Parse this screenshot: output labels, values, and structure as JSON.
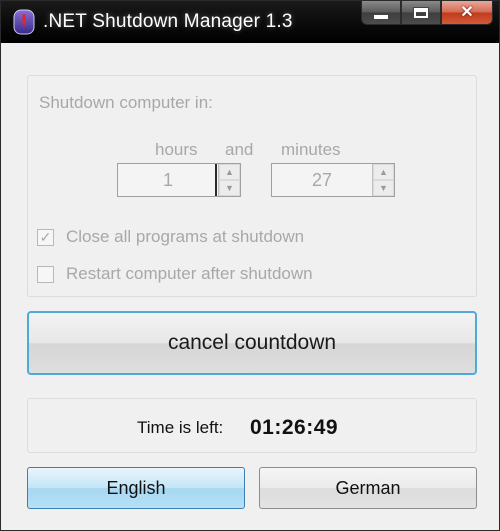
{
  "window": {
    "title": ".NET Shutdown Manager 1.3",
    "icon": "power-app-icon",
    "caption_buttons": [
      "minimize-icon",
      "maximize-icon",
      "close-icon"
    ]
  },
  "settings": {
    "heading": "Shutdown computer in:",
    "hours_label": "hours",
    "and_label": "and",
    "minutes_label": "minutes",
    "hours_value": "1",
    "minutes_value": "27",
    "checkbox_close_label": "Close all programs at shutdown",
    "checkbox_close_checked": true,
    "checkbox_restart_label": "Restart computer after shutdown",
    "checkbox_restart_checked": false
  },
  "actions": {
    "cancel_label": "cancel countdown"
  },
  "timer": {
    "label": "Time is left:",
    "value": "01:26:49"
  },
  "language": {
    "english_label": "English",
    "german_label": "German",
    "selected": "English"
  },
  "colors": {
    "accent_border": "#4ea9dd",
    "selected_button": "#b6e0f5",
    "disabled_text": "#a8a8a8",
    "titlebar": "#000000"
  }
}
